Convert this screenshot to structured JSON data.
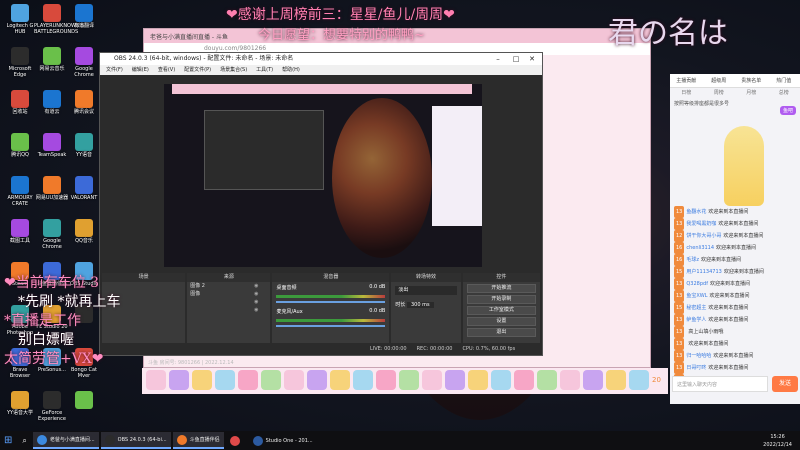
{
  "desktop": {
    "icons_col1": [
      "Logitech G HUB",
      "Microsoft Edge",
      "回收站",
      "腾讯QQ",
      "ARMOURY CRATE",
      "截图工具",
      "Steam",
      "Adobe Photoshop",
      "Brave Browser",
      "YY语音大学"
    ],
    "icons_col2": [
      "PLAYERUNKNOWN'S BATTLEGROUNDS",
      "网易云音乐",
      "有道云",
      "TeamSpeak",
      "网易UU加速器",
      "Google Chrome",
      "斗鱼直播伴侣",
      "FL Studio 20",
      "PreSonus...",
      "GeForce Experience"
    ],
    "icons_col3": [
      "有道翻译",
      "Google Chrome",
      "腾讯会议",
      "YY语音",
      "VALORANT",
      "QQ音乐",
      "OBS Studio",
      "",
      "Bongo Cat Mver",
      ""
    ]
  },
  "overlay": {
    "top_banner": "❤感谢上周榜前三：星星/鱼儿/周周❤",
    "top_banner2": "今日愿望：想要特别的鸭鸭~",
    "big_title": "君の名は",
    "left_lines": [
      "❤当前有车位 3",
      "*先刷 *就再上车",
      "*直播是工作",
      "别白嫖喔",
      "太简劳管+VX❤"
    ]
  },
  "browser": {
    "tab_title": "老爸与小满直播间直播 - 斗鱼",
    "url": "douyu.com/9801266"
  },
  "obs": {
    "title": "OBS 24.0.3 (64-bit, windows) - 配置文件: 未命名 - 场景: 未命名",
    "menu": [
      "文件(F)",
      "编辑(E)",
      "查看(V)",
      "配置文件(P)",
      "场景集合(S)",
      "工具(T)",
      "帮助(H)"
    ],
    "docks": {
      "scenes": "场景",
      "sources": "来源",
      "mixer": "混音器",
      "transitions": "转场特效",
      "controls": "控件"
    },
    "sources_items": [
      "图像 2",
      "图像",
      "",
      ""
    ],
    "mixer_channels": [
      "桌面音频",
      "麦克风/Aux"
    ],
    "mixer_db": [
      "0.0 dB",
      "0.0 dB"
    ],
    "transition_value": "淡出",
    "duration_label": "时长",
    "duration_value": "300 ms",
    "controls": [
      "开始推流",
      "开始录制",
      "工作室模式",
      "设置",
      "退出"
    ],
    "status": {
      "live": "LIVE: 00:00:00",
      "rec": "REC: 00:00:00",
      "cpu": "CPU: 0.7%, 60.00 fps"
    }
  },
  "room": {
    "top_tabs": [
      "主播贡献",
      "超级周",
      "贵族名单",
      "热门值"
    ],
    "sub_tabs": [
      "日榜",
      "周榜",
      "月榜",
      "总榜"
    ],
    "notice": "按照等级排座都是很多号",
    "fan_badge": "鱼吧",
    "chat": [
      {
        "lv": "13",
        "name": "鱼翻水花",
        "msg": "欢迎来到本直播间"
      },
      {
        "lv": "13",
        "name": "我爱喝黑奶咖",
        "msg": "欢迎来到本直播间"
      },
      {
        "lv": "12",
        "name": "饼干你大哥小哥",
        "msg": "欢迎来到本直播间"
      },
      {
        "lv": "16",
        "name": "chenli3114",
        "msg": "欢迎来到本直播间"
      },
      {
        "lv": "16",
        "name": "毛球z",
        "msg": "欢迎来到本直播间"
      },
      {
        "lv": "15",
        "name": "用户11134713",
        "msg": "欢迎来到本直播间"
      },
      {
        "lv": "13",
        "name": "Q328pdf",
        "msg": "欢迎来到本直播间"
      },
      {
        "lv": "13",
        "name": "鱼宝XWL",
        "msg": "欢迎来到本直播间"
      },
      {
        "lv": "15",
        "name": "秘密超主",
        "msg": "欢迎来到本直播间"
      },
      {
        "lv": "13",
        "name": "鲈鱼学人",
        "msg": "欢迎来到本直播间"
      },
      {
        "lv": "13",
        "name": "",
        "msg": "高上山填小雨哦"
      },
      {
        "lv": "13",
        "name": "",
        "msg": "欢迎来到本直播间"
      },
      {
        "lv": "13",
        "name": "归一哈哈哈",
        "msg": "欢迎来到本直播间"
      },
      {
        "lv": "13",
        "name": "日哥叮咚",
        "msg": "欢迎来到本直播间"
      },
      {
        "lv": "13",
        "name": "",
        "msg": "欢迎来到本直播间"
      }
    ],
    "input_placeholder": "这里输入聊天内容",
    "send_label": "发送"
  },
  "streamer_bar": {
    "info": "斗鱼 房间号: 9801266 | 2022.12.14",
    "gift_count": "20"
  },
  "taskbar": {
    "items": [
      "老爸与小满直播间...",
      "OBS 24.0.3 (64-bi...",
      "斗鱼直播伴侣",
      "",
      "Studio One - 201..."
    ],
    "time": "15:26",
    "date": "2022/12/14"
  }
}
